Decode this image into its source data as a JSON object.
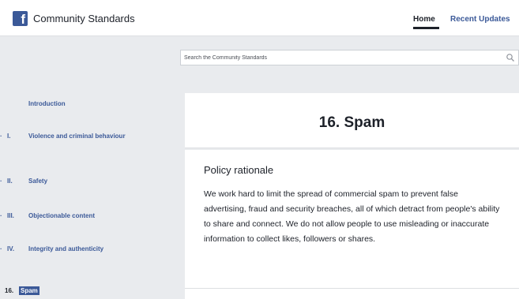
{
  "header": {
    "logo_letter": "f",
    "title": "Community Standards",
    "nav": {
      "home": "Home",
      "recent_updates": "Recent Updates"
    }
  },
  "search": {
    "placeholder": "Search the Community Standards"
  },
  "sidebar": {
    "items": [
      {
        "bullet": "",
        "number": "",
        "label": "Introduction"
      },
      {
        "bullet": "·",
        "number": "I.",
        "label": "Violence and criminal behaviour"
      },
      {
        "bullet": "·",
        "number": "II.",
        "label": "Safety"
      },
      {
        "bullet": "·",
        "number": "III.",
        "label": "Objectionable content"
      },
      {
        "bullet": "·",
        "number": "IV.",
        "label": "Integrity and authenticity"
      }
    ],
    "active": {
      "number": "16.",
      "label": "Spam"
    }
  },
  "main": {
    "title": "16. Spam",
    "section_heading": "Policy rationale",
    "section_text": "We work hard to limit the spread of commercial spam to prevent false advertising, fraud and security breaches, all of which detract from people's ability to share and connect. We do not allow people to use misleading or inaccurate information to collect likes, followers or shares."
  },
  "colors": {
    "brand": "#3b5998",
    "background": "#e9ebee"
  }
}
